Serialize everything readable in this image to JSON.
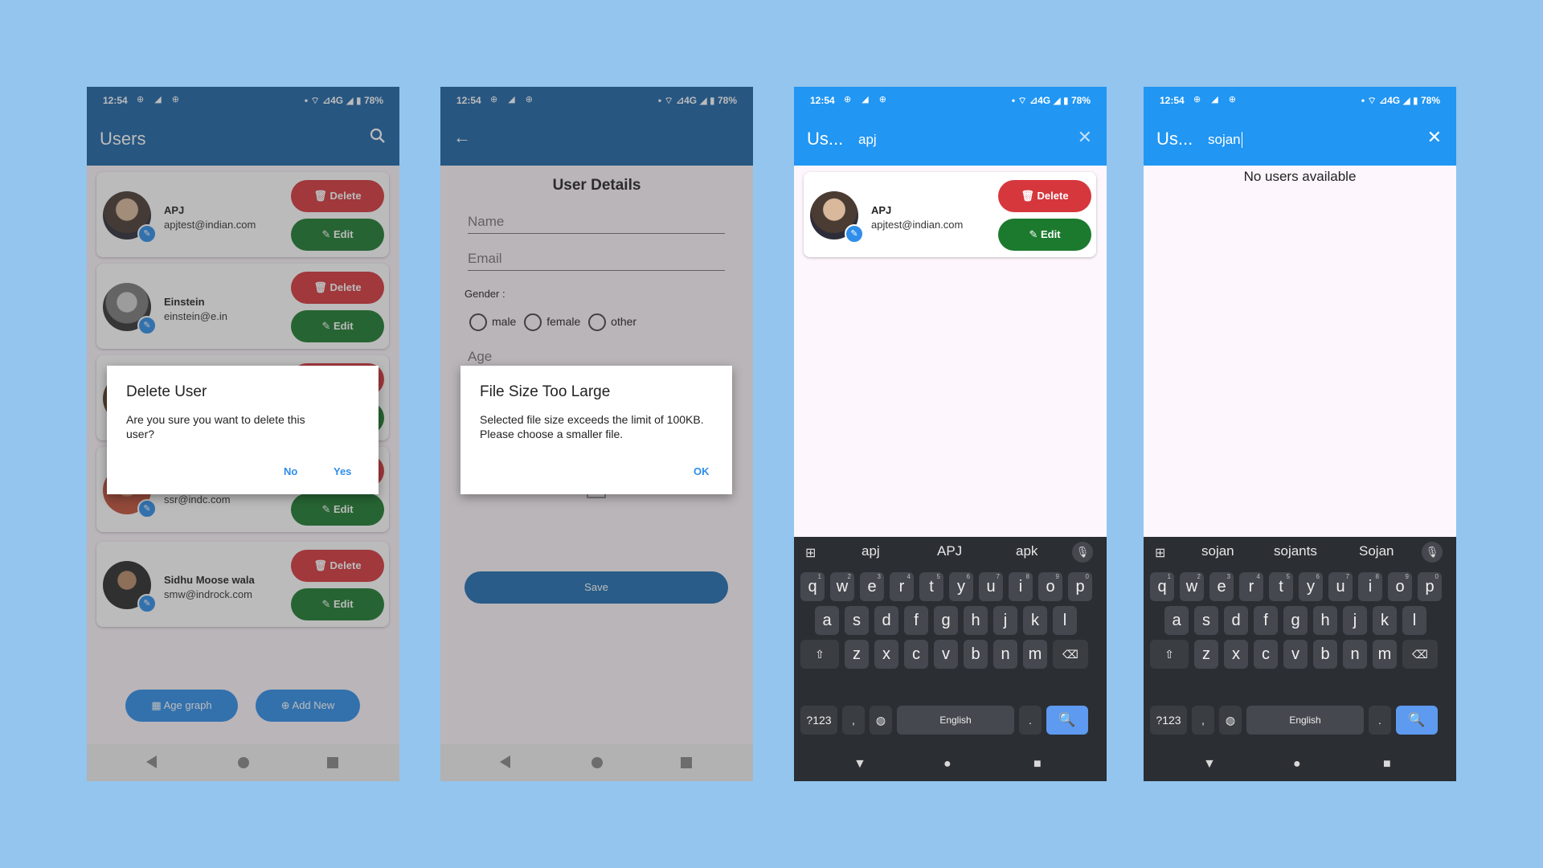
{
  "status_bar": {
    "time": "12:54",
    "left_icons": "⊕ ◢ ⊕",
    "right": "• ⌔ ⊿4G ◢ ▮ 78%"
  },
  "screen1": {
    "title": "Users",
    "search_icon": "search-icon",
    "users": [
      {
        "name": "APJ",
        "email": "apjtest@indian.com"
      },
      {
        "name": "Einstein",
        "email": "einstein@e.in"
      },
      {
        "name": "",
        "email": ""
      },
      {
        "name": "",
        "email": "ssr@indc.com"
      },
      {
        "name": "Sidhu Moose wala",
        "email": "smw@indrock.com"
      }
    ],
    "delete_label": "Delete",
    "edit_label": "Edit",
    "age_graph_label": "Age graph",
    "add_new_label": "Add New",
    "dialog": {
      "title": "Delete User",
      "message": "Are you sure you want to delete this user?",
      "no": "No",
      "yes": "Yes"
    }
  },
  "screen2": {
    "heading": "User Details",
    "name_placeholder": "Name",
    "email_placeholder": "Email",
    "gender_label": "Gender :",
    "gender_options": [
      "male",
      "female",
      "other"
    ],
    "age_placeholder": "Age",
    "save_label": "Save",
    "dialog": {
      "title": "File Size Too Large",
      "message": "Selected file size exceeds the limit of 100KB. Please choose a smaller file.",
      "ok": "OK"
    }
  },
  "screen3": {
    "title": "Us...",
    "query": "apj",
    "result": {
      "name": "APJ",
      "email": "apjtest@indian.com"
    },
    "delete_label": "Delete",
    "edit_label": "Edit",
    "suggestions": [
      "apj",
      "APJ",
      "apk"
    ]
  },
  "screen4": {
    "title": "Us...",
    "query": "sojan",
    "empty_message": "No users available",
    "suggestions": [
      "sojan",
      "sojants",
      "Sojan"
    ]
  },
  "keyboard": {
    "row1": [
      "q",
      "w",
      "e",
      "r",
      "t",
      "y",
      "u",
      "i",
      "o",
      "p"
    ],
    "row1_hints": [
      "1",
      "2",
      "3",
      "4",
      "5",
      "6",
      "7",
      "8",
      "9",
      "0"
    ],
    "row2": [
      "a",
      "s",
      "d",
      "f",
      "g",
      "h",
      "j",
      "k",
      "l"
    ],
    "row3": [
      "z",
      "x",
      "c",
      "v",
      "b",
      "n",
      "m"
    ],
    "symbols_label": "?123",
    "comma_label": ",",
    "space_label": "English",
    "period_label": "."
  },
  "colors": {
    "app_bar_dark": "#1D65A6",
    "app_bar_light": "#2196F3",
    "delete": "#D6373D",
    "edit": "#1C7A2E",
    "accent": "#2F8EEA"
  }
}
